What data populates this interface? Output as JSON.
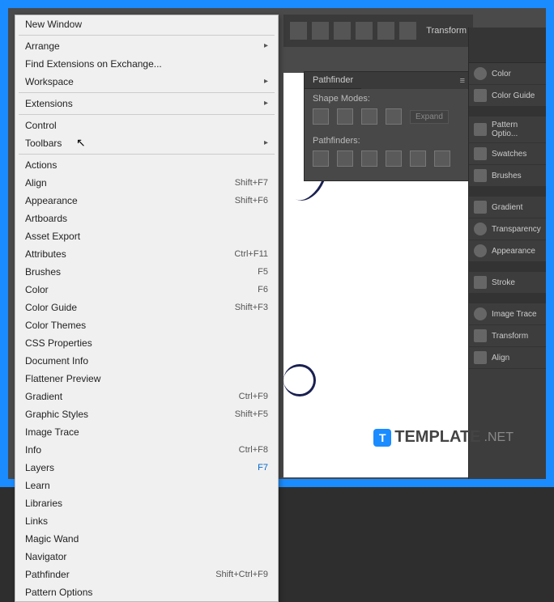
{
  "menu": {
    "new_window": "New Window",
    "arrange": "Arrange",
    "find_ext": "Find Extensions on Exchange...",
    "workspace": "Workspace",
    "extensions": "Extensions",
    "control": "Control",
    "toolbars": "Toolbars",
    "actions": "Actions",
    "align": {
      "label": "Align",
      "key": "Shift+F7"
    },
    "appearance": {
      "label": "Appearance",
      "key": "Shift+F6"
    },
    "artboards": "Artboards",
    "asset_export": "Asset Export",
    "attributes": {
      "label": "Attributes",
      "key": "Ctrl+F11"
    },
    "brushes": {
      "label": "Brushes",
      "key": "F5"
    },
    "color": {
      "label": "Color",
      "key": "F6"
    },
    "color_guide": {
      "label": "Color Guide",
      "key": "Shift+F3"
    },
    "color_themes": "Color Themes",
    "css_props": "CSS Properties",
    "doc_info": "Document Info",
    "flattener": "Flattener Preview",
    "gradient": {
      "label": "Gradient",
      "key": "Ctrl+F9"
    },
    "graphic_styles": {
      "label": "Graphic Styles",
      "key": "Shift+F5"
    },
    "image_trace": "Image Trace",
    "info": {
      "label": "Info",
      "key": "Ctrl+F8"
    },
    "layers": {
      "label": "Layers",
      "key": "F7"
    },
    "learn": "Learn",
    "libraries": "Libraries",
    "links": "Links",
    "magic_wand": "Magic Wand",
    "navigator": "Navigator",
    "pathfinder": {
      "label": "Pathfinder",
      "key": "Shift+Ctrl+F9"
    },
    "pattern_options": "Pattern Options"
  },
  "toolbar": {
    "transform": "Transform"
  },
  "pathfinder_panel": {
    "title": "Pathfinder",
    "shape_modes": "Shape Modes:",
    "pathfinders": "Pathfinders:",
    "expand": "Expand"
  },
  "right_panels": {
    "color": "Color",
    "color_guide": "Color Guide",
    "pattern_opt": "Pattern Optio...",
    "swatches": "Swatches",
    "brushes": "Brushes",
    "gradient": "Gradient",
    "transparency": "Transparency",
    "appearance": "Appearance",
    "stroke": "Stroke",
    "image_trace": "Image Trace",
    "transform": "Transform",
    "align": "Align"
  },
  "watermark": {
    "brand": "TEMPLATE",
    "ext": ".NET",
    "badge": "T"
  }
}
